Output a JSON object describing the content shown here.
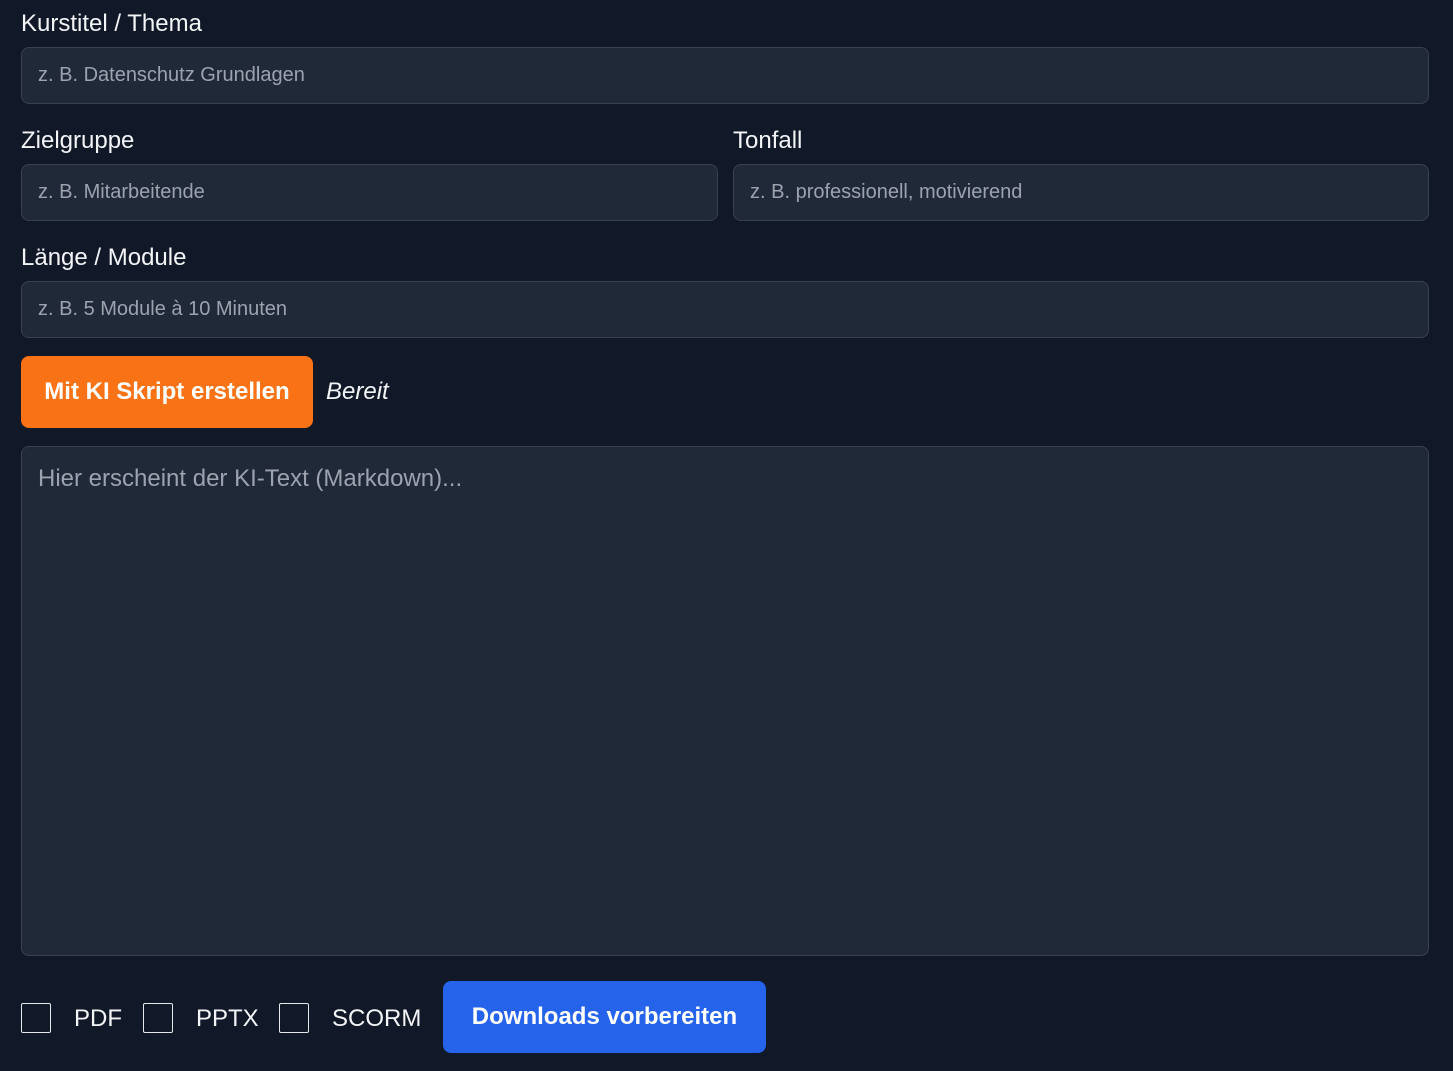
{
  "form": {
    "course_title": {
      "label": "Kurstitel / Thema",
      "placeholder": "z. B. Datenschutz Grundlagen",
      "value": ""
    },
    "audience": {
      "label": "Zielgruppe",
      "placeholder": "z. B. Mitarbeitende",
      "value": ""
    },
    "tone": {
      "label": "Tonfall",
      "placeholder": "z. B. professionell, motivierend",
      "value": ""
    },
    "length": {
      "label": "Länge / Module",
      "placeholder": "z. B. 5 Module à 10 Minuten",
      "value": ""
    }
  },
  "actions": {
    "generate_label": "Mit KI Skript erstellen",
    "status": "Bereit",
    "generate_color": "#f97316"
  },
  "output": {
    "placeholder": "Hier erscheint der KI-Text (Markdown)...",
    "value": ""
  },
  "exports": {
    "options": [
      {
        "label": "PDF",
        "checked": false
      },
      {
        "label": "PPTX",
        "checked": false
      },
      {
        "label": "SCORM",
        "checked": false
      }
    ],
    "download_label": "Downloads vorbereiten",
    "download_color": "#2563eb"
  }
}
